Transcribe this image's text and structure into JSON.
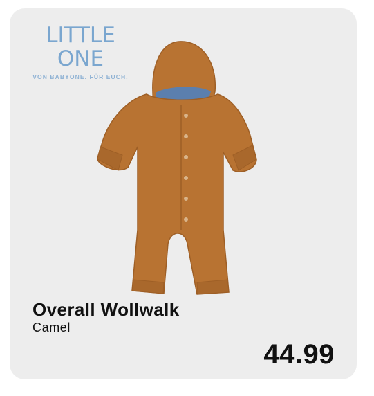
{
  "brand": {
    "logo_main": "LITTLE ONE",
    "logo_sub": "VON BABYONE. FÜR EUCH."
  },
  "product": {
    "name": "Overall Wollwalk",
    "color": "Camel",
    "price": "44.99",
    "image_icon": "baby-overall-image"
  },
  "colors": {
    "card_bg": "#ededed",
    "brand_blue": "#7aa6cf",
    "garment_camel": "#b87332",
    "lining_blue": "#5b7fae"
  }
}
